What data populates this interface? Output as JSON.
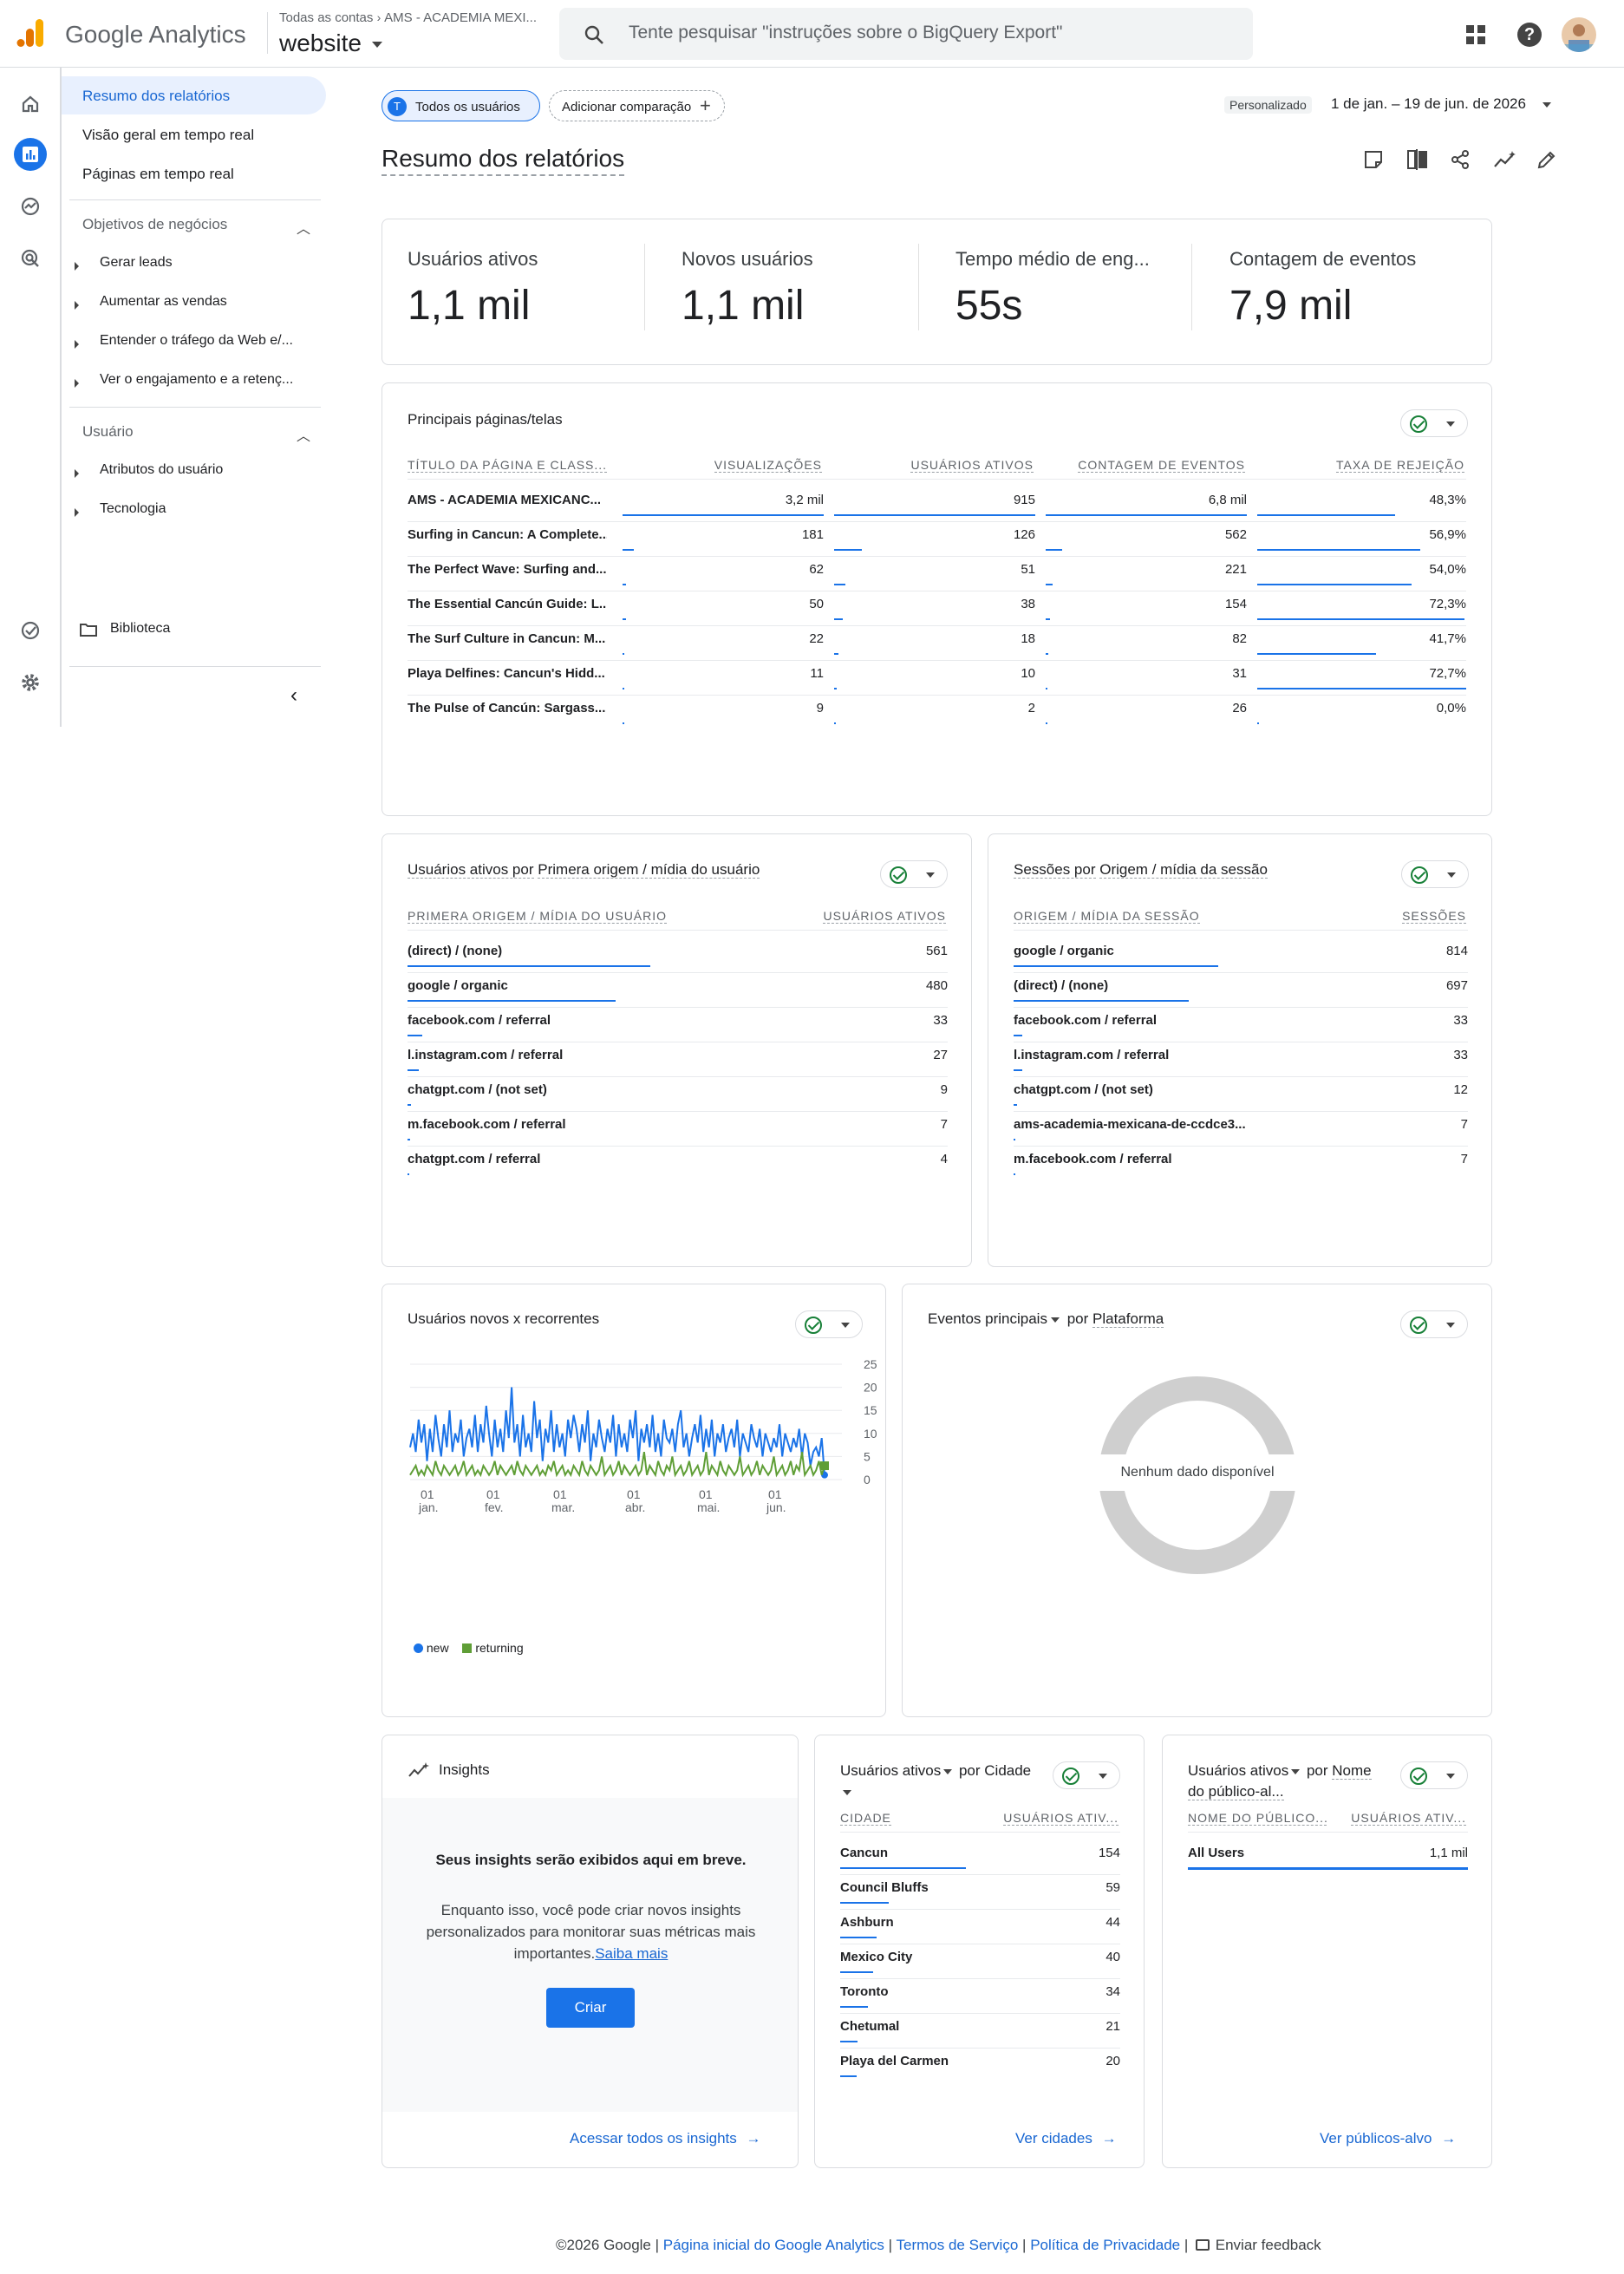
{
  "app": {
    "name": "Google Analytics",
    "breadcrumb_root": "Todas as contas",
    "breadcrumb_account": "AMS - ACADEMIA MEXI...",
    "property": "website",
    "search_placeholder": "Tente pesquisar \"instruções sobre o BigQuery Export\""
  },
  "nav": {
    "items": [
      "Resumo dos relatórios",
      "Visão geral em tempo real",
      "Páginas em tempo real"
    ],
    "section1": "Objetivos de negócios",
    "section1_items": [
      "Gerar leads",
      "Aumentar as vendas",
      "Entender o tráfego da Web e/...",
      "Ver o engajamento e a retenç..."
    ],
    "section2": "Usuário",
    "section2_items": [
      "Atributos do usuário",
      "Tecnologia"
    ],
    "library": "Biblioteca"
  },
  "toolbar": {
    "segment": "Todos os usuários",
    "segment_initial": "T",
    "add_comparison": "Adicionar comparação",
    "date_badge": "Personalizado",
    "date_range": "1 de jan. – 19 de jun. de 2026"
  },
  "page_title": "Resumo dos relatórios",
  "kpis": [
    {
      "label": "Usuários ativos",
      "value": "1,1 mil"
    },
    {
      "label": "Novos usuários",
      "value": "1,1 mil"
    },
    {
      "label": "Tempo médio de eng...",
      "value": "55s"
    },
    {
      "label": "Contagem de eventos",
      "value": "7,9 mil"
    }
  ],
  "pages_table": {
    "title": "Principais páginas/telas",
    "headers": [
      "TÍTULO DA PÁGINA E CLASS...",
      "VISUALIZAÇÕES",
      "USUÁRIOS ATIVOS",
      "CONTAGEM DE EVENTOS",
      "TAXA DE REJEIÇÃO"
    ],
    "rows": [
      {
        "title": "AMS - ACADEMIA MEXICANC...",
        "views": "3,2 mil",
        "users": "915",
        "events": "6,8 mil",
        "bounce": "48,3%"
      },
      {
        "title": "Surfing in Cancun: A Complete...",
        "views": "181",
        "users": "126",
        "events": "562",
        "bounce": "56,9%"
      },
      {
        "title": "The Perfect Wave: Surfing and...",
        "views": "62",
        "users": "51",
        "events": "221",
        "bounce": "54,0%"
      },
      {
        "title": "The Essential Cancún Guide: L...",
        "views": "50",
        "users": "38",
        "events": "154",
        "bounce": "72,3%"
      },
      {
        "title": "The Surf Culture in Cancun: M...",
        "views": "22",
        "users": "18",
        "events": "82",
        "bounce": "41,7%"
      },
      {
        "title": "Playa Delfines: Cancun's Hidd...",
        "views": "11",
        "users": "10",
        "events": "31",
        "bounce": "72,7%"
      },
      {
        "title": "The Pulse of Cancún: Sargass...",
        "views": "9",
        "users": "2",
        "events": "26",
        "bounce": "0,0%"
      }
    ],
    "bar_fractions": {
      "views": [
        1,
        0.057,
        0.019,
        0.016,
        0.007,
        0.003,
        0.003
      ],
      "users": [
        1,
        0.138,
        0.056,
        0.042,
        0.02,
        0.011,
        0.002
      ],
      "events": [
        1,
        0.083,
        0.033,
        0.023,
        0.012,
        0.005,
        0.004
      ],
      "bounce": [
        0.66,
        0.78,
        0.74,
        0.99,
        0.57,
        1,
        0
      ]
    }
  },
  "users_source": {
    "title_a": "Usuários ativos por",
    "title_b": "Primera origem / mídia do usuário",
    "headers": [
      "PRIMERA ORIGEM / MÍDIA DO USUÁRIO",
      "USUÁRIOS ATIVOS"
    ],
    "rows": [
      {
        "k": "(direct) / (none)",
        "v": "561"
      },
      {
        "k": "google / organic",
        "v": "480"
      },
      {
        "k": "facebook.com / referral",
        "v": "33"
      },
      {
        "k": "l.instagram.com / referral",
        "v": "27"
      },
      {
        "k": "chatgpt.com / (not set)",
        "v": "9"
      },
      {
        "k": "m.facebook.com / referral",
        "v": "7"
      },
      {
        "k": "chatgpt.com / referral",
        "v": "4"
      }
    ],
    "fractions": [
      1,
      0.856,
      0.059,
      0.048,
      0.016,
      0.012,
      0.007
    ]
  },
  "sessions_source": {
    "title_a": "Sessões por",
    "title_b": "Origem / mídia da sessão",
    "headers": [
      "ORIGEM / MÍDIA DA SESSÃO",
      "SESSÕES"
    ],
    "rows": [
      {
        "k": "google / organic",
        "v": "814"
      },
      {
        "k": "(direct) / (none)",
        "v": "697"
      },
      {
        "k": "facebook.com / referral",
        "v": "33"
      },
      {
        "k": "l.instagram.com / referral",
        "v": "33"
      },
      {
        "k": "chatgpt.com / (not set)",
        "v": "12"
      },
      {
        "k": "ams-academia-mexicana-de-ccdce3...",
        "v": "7"
      },
      {
        "k": "m.facebook.com / referral",
        "v": "7"
      }
    ],
    "fractions": [
      1,
      0.856,
      0.041,
      0.041,
      0.015,
      0.009,
      0.009
    ]
  },
  "new_returning": {
    "title": "Usuários novos x recorrentes",
    "legend": [
      "new",
      "returning"
    ]
  },
  "chart_data": {
    "type": "line",
    "x_ticks": [
      [
        "01",
        "jan."
      ],
      [
        "01",
        "fev."
      ],
      [
        "01",
        "mar."
      ],
      [
        "01",
        "abr."
      ],
      [
        "01",
        "mai."
      ],
      [
        "01",
        "jun."
      ]
    ],
    "y_ticks": [
      "25",
      "20",
      "15",
      "10",
      "5",
      "0"
    ],
    "ylim": [
      0,
      25
    ],
    "series": [
      {
        "name": "new",
        "color": "#1a73e8",
        "values": [
          7,
          10,
          6,
          13,
          8,
          12,
          4,
          11,
          6,
          14,
          9,
          5,
          12,
          7,
          15,
          6,
          10,
          8,
          13,
          5,
          9,
          11,
          7,
          14,
          6,
          12,
          8,
          16,
          10,
          5,
          13,
          7,
          11,
          6,
          15,
          9,
          20,
          8,
          12,
          5,
          14,
          7,
          10,
          6,
          17,
          9,
          13,
          4,
          11,
          8,
          15,
          6,
          12,
          7,
          10,
          5,
          13,
          9,
          14,
          11,
          6,
          12,
          8,
          15,
          4,
          10,
          7,
          13,
          9,
          6,
          11,
          8,
          14,
          5,
          12,
          7,
          10,
          6,
          13,
          9,
          15,
          4,
          11,
          8,
          12,
          7,
          14,
          6,
          10,
          5,
          13,
          9,
          8,
          11,
          6,
          12,
          15,
          7,
          10,
          5,
          9,
          12,
          8,
          14,
          6,
          11,
          7,
          13,
          5,
          10,
          8,
          12,
          6,
          9,
          11,
          7,
          13,
          5,
          10,
          8,
          6,
          12,
          9,
          7,
          11,
          5,
          10,
          8,
          6,
          9,
          7,
          12,
          5,
          10,
          8,
          6,
          9,
          7,
          11,
          5,
          10,
          8,
          3,
          6,
          7,
          5,
          9,
          1
        ]
      },
      {
        "name": "returning",
        "color": "#5f9e36",
        "values": [
          1,
          2,
          3,
          1,
          2,
          1,
          3,
          2,
          1,
          4,
          2,
          1,
          3,
          2,
          1,
          2,
          3,
          1,
          2,
          4,
          1,
          2,
          3,
          1,
          2,
          1,
          3,
          2,
          1,
          2,
          4,
          1,
          3,
          2,
          1,
          2,
          3,
          1,
          4,
          2,
          1,
          3,
          2,
          1,
          2,
          3,
          1,
          2,
          1,
          3,
          2,
          4,
          1,
          2,
          3,
          1,
          2,
          1,
          3,
          2,
          1,
          4,
          2,
          1,
          3,
          2,
          1,
          2,
          5,
          1,
          2,
          3,
          1,
          2,
          4,
          1,
          3,
          2,
          1,
          2,
          3,
          1,
          2,
          6,
          1,
          3,
          2,
          1,
          4,
          2,
          1,
          3,
          2,
          5,
          1,
          2,
          3,
          1,
          2,
          4,
          1,
          2,
          3,
          1,
          2,
          6,
          1,
          3,
          2,
          1,
          4,
          2,
          1,
          3,
          2,
          1,
          2,
          5,
          1,
          2,
          3,
          1,
          2,
          4,
          1,
          3,
          2,
          1,
          2,
          5,
          1,
          2,
          3,
          1,
          2,
          4,
          1,
          3,
          2,
          6,
          1,
          2,
          3,
          1,
          2,
          4,
          1,
          3
        ]
      }
    ]
  },
  "events_platform": {
    "title_a": "Eventos principais",
    "title_b": "por",
    "title_c": "Plataforma",
    "empty": "Nenhum dado disponível"
  },
  "insights": {
    "title": "Insights",
    "headline": "Seus insights serão exibidos aqui em breve.",
    "body": "Enquanto isso, você pode criar novos insights personalizados para monitorar suas métricas mais importantes.",
    "learn_more": "Saiba mais",
    "create": "Criar",
    "link": "Acessar todos os insights"
  },
  "cities": {
    "title_a": "Usuários ativos",
    "title_b": "por",
    "title_c": "Cidade",
    "headers": [
      "CIDADE",
      "USUÁRIOS ATIV..."
    ],
    "rows": [
      {
        "k": "Cancun",
        "v": "154"
      },
      {
        "k": "Council Bluffs",
        "v": "59"
      },
      {
        "k": "Ashburn",
        "v": "44"
      },
      {
        "k": "Mexico City",
        "v": "40"
      },
      {
        "k": "Toronto",
        "v": "34"
      },
      {
        "k": "Chetumal",
        "v": "21"
      },
      {
        "k": "Playa del Carmen",
        "v": "20"
      }
    ],
    "fractions": [
      1,
      0.383,
      0.286,
      0.26,
      0.221,
      0.136,
      0.13
    ],
    "link": "Ver cidades"
  },
  "audiences": {
    "title_a": "Usuários ativos",
    "title_b": "por",
    "title_c": "Nome do público-al...",
    "headers": [
      "NOME DO PÚBLICO...",
      "USUÁRIOS ATIV..."
    ],
    "rows": [
      {
        "k": "All Users",
        "v": "1,1 mil"
      }
    ],
    "fractions": [
      1
    ],
    "link": "Ver públicos-alvo"
  },
  "footer": {
    "copyright": "©2026 Google |",
    "home": "Página inicial do Google Analytics",
    "sep1": "|",
    "terms": "Termos de Serviço",
    "sep2": "|",
    "privacy": "Política de Privacidade",
    "sep3": "|",
    "feedback": "Enviar feedback"
  }
}
